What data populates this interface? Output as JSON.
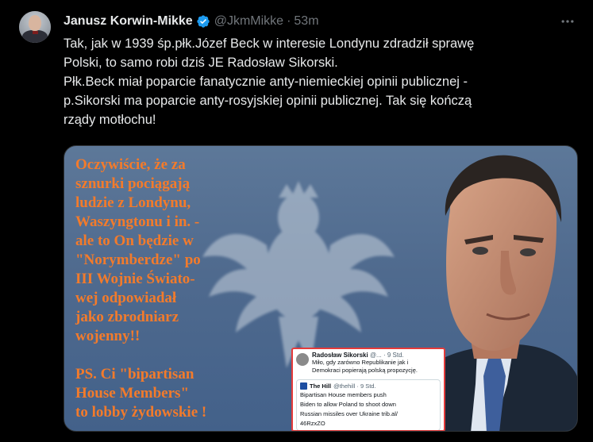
{
  "author": {
    "name": "Janusz Korwin-Mikke",
    "handle": "@JkmMikke",
    "separator": "·",
    "time": "53m"
  },
  "tweet": {
    "lines": [
      "Tak, jak w 1939 śp.płk.Józef Beck w interesie Londynu zdradził sprawę",
      "Polski, to samo robi dziś JE Radosław Sikorski.",
      "Płk.Beck miał poparcie fanatycznie anty-niemieckiej opinii publicznej -",
      "p.Sikorski ma poparcie anty-rosyjskiej opinii publicznej. Tak się kończą",
      "rządy motłochu!"
    ]
  },
  "media": {
    "overlay_lines": [
      "Oczywiście, że za",
      "sznurki pociągają",
      "ludzie z Londynu,",
      "Waszyngtonu i in. -",
      "ale to On będzie w",
      "\"Norymberdze\" po",
      "III Wojnie Świato-",
      "wej odpowiadał",
      "jako zbrodniarz",
      "wojenny!!"
    ],
    "overlay_ps_lines": [
      "PS. Ci \"bipartisan",
      "House Members\"",
      "to lobby żydowskie !"
    ],
    "overlay_color": "#f37b2b",
    "embed": {
      "author": "Radosław Sikorski",
      "meta": "@... · 9 Std.",
      "text_lines": [
        "Miło, gdy zarówno Republikanie jak i",
        "Demokraci popierają polską propozycję."
      ],
      "quoted_author": "The Hill",
      "quoted_meta": "@thehill · 9 Std.",
      "quoted_lines": [
        "Bipartisan House members push",
        "Biden to allow Poland to shoot down",
        "Russian missiles over Ukraine trib.al/",
        "46RzxZO"
      ]
    }
  },
  "icons": {
    "verified": "verified-badge-icon",
    "more": "more-options-icon"
  },
  "colors": {
    "background": "#000000",
    "text": "#e7e9ea",
    "secondary": "#71767b",
    "verified": "#1d9bf0"
  }
}
